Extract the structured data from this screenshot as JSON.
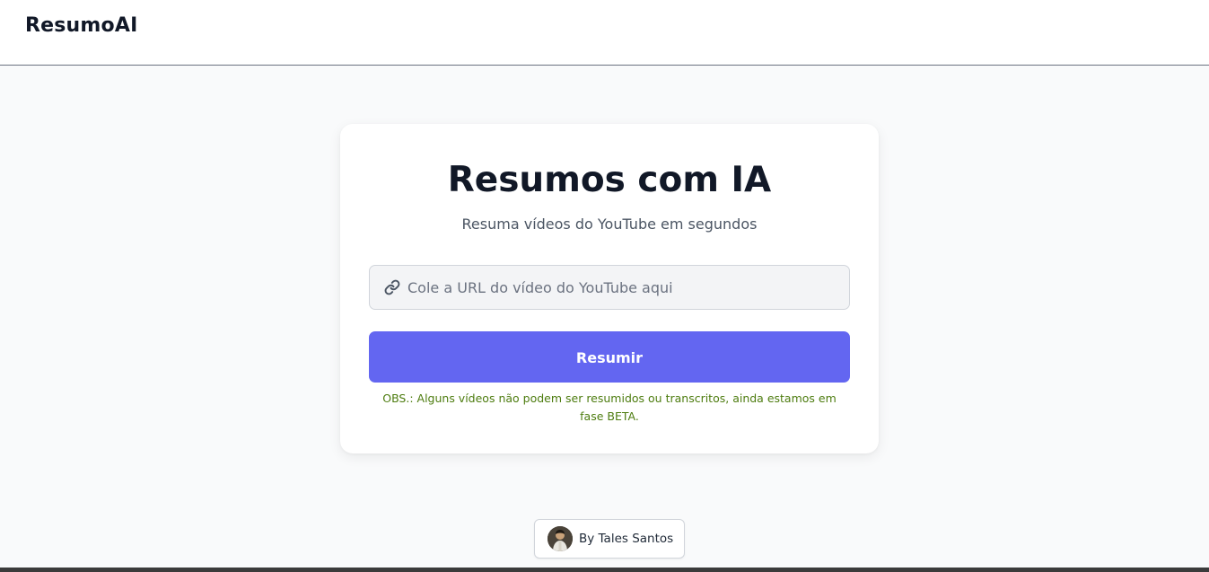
{
  "header": {
    "brand": "ResumoAI"
  },
  "main": {
    "title": "Resumos com IA",
    "subtitle": "Resuma vídeos do YouTube em segundos",
    "url_input": {
      "value": "",
      "placeholder": "Cole a URL do vídeo do YouTube aqui",
      "icon": "link-icon"
    },
    "submit_label": "Resumir",
    "note": "OBS.: Alguns vídeos não podem ser resumidos ou transcritos, ainda estamos em fase BETA."
  },
  "footer": {
    "author_label": "By Tales Santos"
  },
  "colors": {
    "accent": "#6366f1",
    "note_text": "#4d7c0f",
    "background": "#f9fafb",
    "input_bg": "#f3f4f6"
  }
}
